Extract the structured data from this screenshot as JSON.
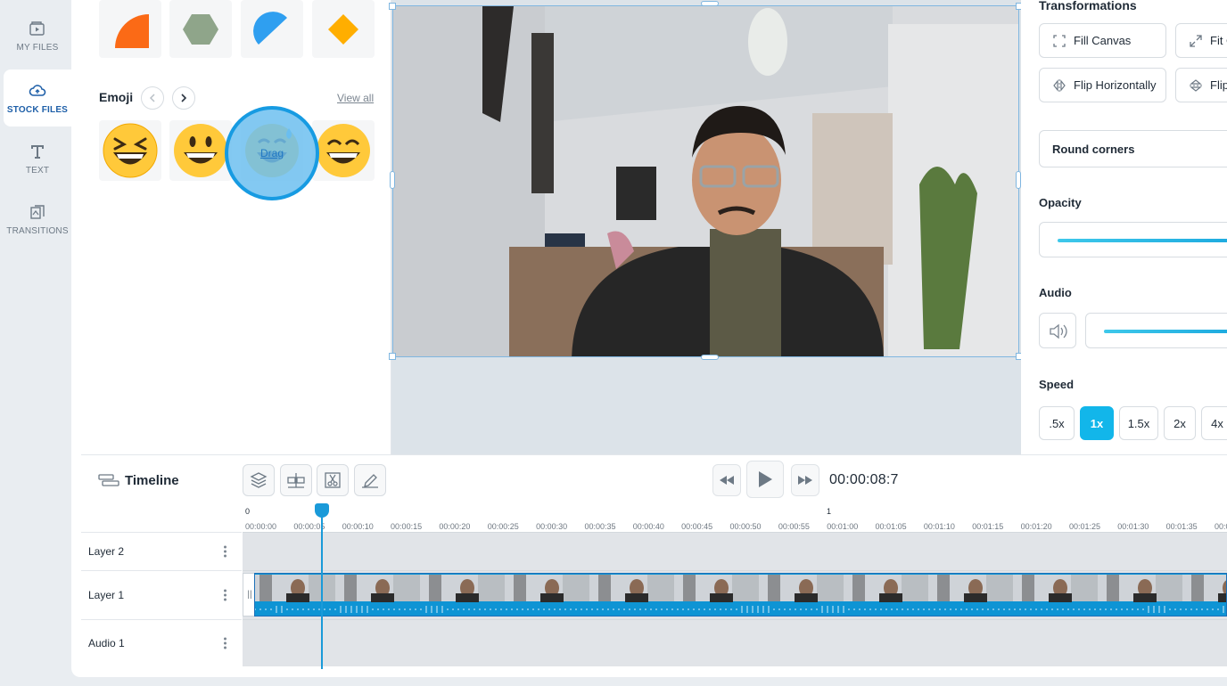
{
  "nav": {
    "items": [
      {
        "label": "MY FILES",
        "icon": "video-folder-icon",
        "active": false
      },
      {
        "label": "STOCK FILES",
        "icon": "cloud-icon",
        "active": true
      },
      {
        "label": "TEXT",
        "icon": "text-icon",
        "active": false
      },
      {
        "label": "TRANSITIONS",
        "icon": "transitions-icon",
        "active": false
      }
    ]
  },
  "stock": {
    "shapes": [
      "quarter-circle-icon",
      "hexagon-icon",
      "semicircle-icon",
      "diamond-icon"
    ],
    "emoji_title": "Emoji",
    "view_all": "View all",
    "prev_icon": "chevron-left-icon",
    "next_icon": "chevron-right-icon",
    "drag_text": "Drag",
    "emojis": [
      "squinting-laugh-emoji",
      "grinning-emoji",
      "sweat-smile-emoji",
      "beaming-smile-emoji"
    ]
  },
  "props": {
    "transformations_title": "Transformations",
    "fill_canvas": "Fill Canvas",
    "fit": "Fit C",
    "flip_h": "Flip Horizontally",
    "flip_v": "Flip",
    "round_corners": "Round corners",
    "opacity_title": "Opacity",
    "audio_title": "Audio",
    "speed_title": "Speed",
    "speeds": [
      ".5x",
      "1x",
      "1.5x",
      "2x",
      "4x"
    ],
    "active_speed": "1x"
  },
  "timeline": {
    "title": "Timeline",
    "timecode": "00:00:08:7",
    "major_marks": [
      "0",
      "1"
    ],
    "ticks": [
      "00:00:00",
      "00:00:05",
      "00:00:10",
      "00:00:15",
      "00:00:20",
      "00:00:25",
      "00:00:30",
      "00:00:35",
      "00:00:40",
      "00:00:45",
      "00:00:50",
      "00:00:55",
      "00:01:00",
      "00:01:05",
      "00:01:10",
      "00:01:15",
      "00:01:20",
      "00:01:25",
      "00:01:30",
      "00:01:35",
      "00:0"
    ],
    "layers": [
      "Layer 2",
      "Layer 1",
      "Audio 1"
    ]
  },
  "colors": {
    "accent": "#12b6ea",
    "active_nav_text": "#1e5fa8",
    "clip": "#0e94d4"
  }
}
